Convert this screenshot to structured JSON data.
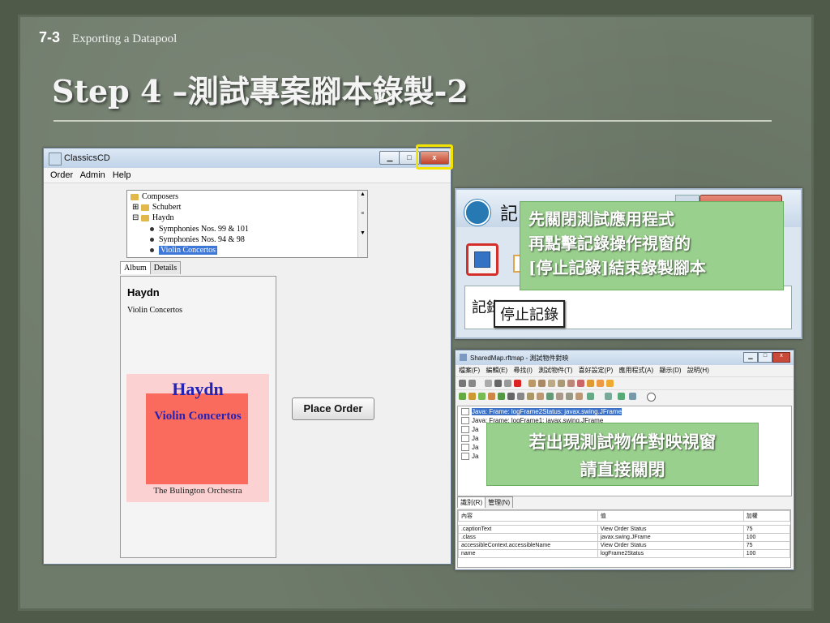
{
  "slide": {
    "section_number": "7-3",
    "section_title": "Exporting a Datapool",
    "title": "Step 4 –測試專案腳本錄製-2"
  },
  "classics_window": {
    "title": "ClassicsCD",
    "controls": {
      "minimize": "▁",
      "maximize": "□",
      "close": "x"
    },
    "menu": [
      "Order",
      "Admin",
      "Help"
    ],
    "tree": {
      "root": "Composers",
      "nodes": [
        "Schubert",
        "Haydn"
      ],
      "leaves": [
        "Symphonies Nos. 99 & 101",
        "Symphonies Nos. 94 & 98",
        "Violin Concertos"
      ]
    },
    "tabs": [
      "Album",
      "Details"
    ],
    "album": {
      "artist": "Haydn",
      "album_title": "Violin Concertos",
      "cover_line1": "Haydn",
      "cover_line2": "Violin Concertos",
      "cover_line3": "The Bulington Orchestra"
    },
    "place_order_button": "Place Order"
  },
  "recording_window": {
    "title_fragment": "記",
    "lower_label": "記錄",
    "tooltip": "停止記錄"
  },
  "note_close_app": {
    "line1": "先關閉測試應用程式",
    "line2": "再點擊記錄操作視窗的",
    "line3": "[停止記錄]結束錄製腳本"
  },
  "note_close_map": {
    "line1": "若出現測試物件對映視窗",
    "line2": "請直接關閉"
  },
  "sharedmap_window": {
    "title": "SharedMap.rftmap - 測試物件對映",
    "menu": [
      "檔案(F)",
      "編輯(E)",
      "尋找(I)",
      "測試物件(T)",
      "喜好設定(P)",
      "應用程式(A)",
      "顯示(D)",
      "說明(H)"
    ],
    "list": [
      "Java: Frame: logFrame2Status: javax.swing.JFrame",
      "Java: Frame: logFrame1: javax.swing.JFrame",
      "Ja",
      "Ja",
      "Ja",
      "Ja"
    ],
    "bottom_tabs": [
      "識別(R)",
      "管理(N)"
    ],
    "props_headers": [
      "內容",
      "值",
      "加權"
    ],
    "props_rows": [
      [
        ".captionText",
        "View Order Status",
        "75"
      ],
      [
        ".class",
        "javax.swing.JFrame",
        "100"
      ],
      [
        "accessibleContext.accessibleName",
        "View Order Status",
        "75"
      ],
      [
        "name",
        "logFrame2Status",
        "100"
      ]
    ]
  }
}
